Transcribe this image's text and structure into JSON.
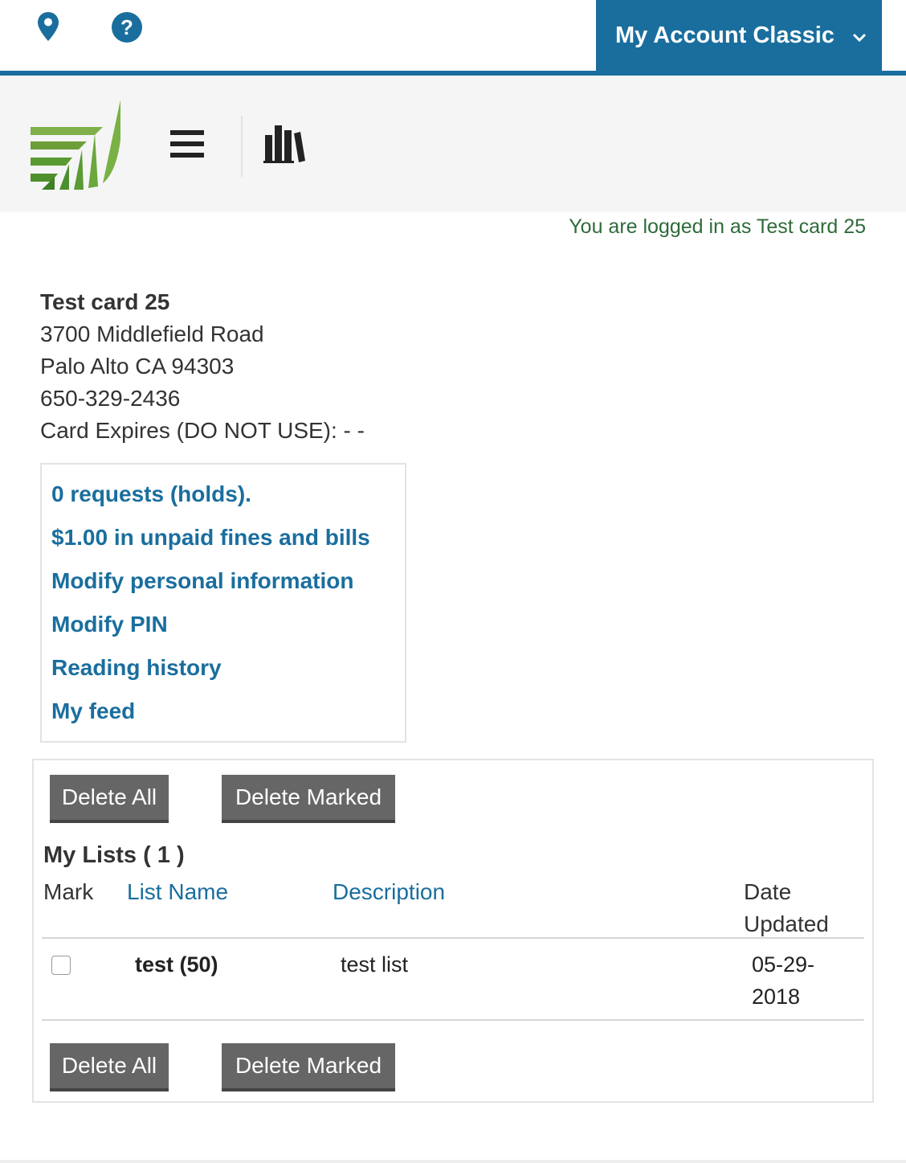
{
  "topbar": {
    "account_label": "My Account Classic",
    "icons": [
      "map-pin-icon",
      "help-circle-icon",
      "chevron-down-icon"
    ],
    "accent_color": "#1a6e9e"
  },
  "header": {
    "icons": [
      "library-logo",
      "hamburger-menu-icon",
      "books-icon"
    ],
    "logged_in_text": "You are logged in as Test card 25"
  },
  "patron": {
    "name": "Test card 25",
    "address_line1": "3700 Middlefield Road",
    "address_line2": "Palo Alto CA 94303",
    "phone": "650-329-2436",
    "card_expires": "Card Expires (DO NOT USE): - -"
  },
  "account_links": [
    "0 requests (holds).",
    "$1.00 in unpaid fines and bills",
    "Modify personal information",
    "Modify PIN",
    "Reading history",
    "My feed"
  ],
  "lists": {
    "delete_all_label": "Delete All",
    "delete_marked_label": "Delete Marked",
    "title": "My Lists ( 1 )",
    "columns": {
      "mark": "Mark",
      "list_name": "List Name",
      "description": "Description",
      "date_updated": "Date Updated"
    },
    "rows": [
      {
        "name": "test (50)",
        "description": "test list",
        "date": "05-29-2018",
        "checked": false
      }
    ]
  }
}
